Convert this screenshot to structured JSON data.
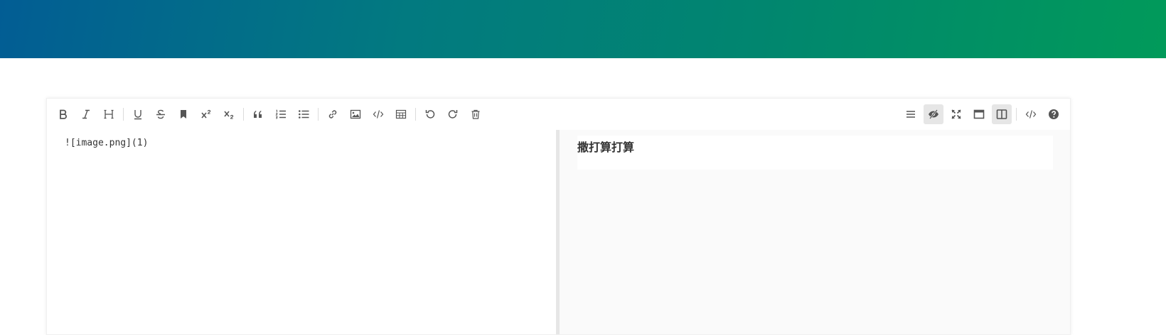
{
  "editor": {
    "source_text": "![image.png](1)",
    "preview_text": "撒打算打算"
  },
  "toolbar": {
    "left_tools": [
      {
        "name": "bold",
        "icon": "bold-icon"
      },
      {
        "name": "italic",
        "icon": "italic-icon"
      },
      {
        "name": "heading",
        "icon": "heading-icon"
      },
      {
        "name": "underline",
        "icon": "underline-icon"
      },
      {
        "name": "strikethrough",
        "icon": "strikethrough-icon"
      },
      {
        "name": "mark",
        "icon": "bookmark-icon"
      },
      {
        "name": "superscript",
        "icon": "superscript-icon"
      },
      {
        "name": "subscript",
        "icon": "subscript-icon"
      },
      {
        "name": "quote",
        "icon": "quote-icon"
      },
      {
        "name": "ordered-list",
        "icon": "ordered-list-icon"
      },
      {
        "name": "unordered-list",
        "icon": "unordered-list-icon"
      },
      {
        "name": "link",
        "icon": "link-icon"
      },
      {
        "name": "image",
        "icon": "image-icon"
      },
      {
        "name": "code",
        "icon": "code-icon"
      },
      {
        "name": "table",
        "icon": "table-icon"
      },
      {
        "name": "undo",
        "icon": "undo-icon"
      },
      {
        "name": "redo",
        "icon": "redo-icon"
      },
      {
        "name": "trash",
        "icon": "trash-icon"
      }
    ],
    "right_tools": [
      {
        "name": "navigation",
        "icon": "list-icon",
        "active": false
      },
      {
        "name": "preview-toggle",
        "icon": "eye-slash-icon",
        "active": true
      },
      {
        "name": "fullscreen",
        "icon": "expand-icon",
        "active": false
      },
      {
        "name": "read-mode",
        "icon": "window-icon",
        "active": false
      },
      {
        "name": "subfield",
        "icon": "columns-icon",
        "active": true
      },
      {
        "name": "html-code",
        "icon": "code-icon",
        "active": false
      },
      {
        "name": "help",
        "icon": "help-icon",
        "active": false
      }
    ]
  },
  "colors": {
    "banner_start": "#025d94",
    "banner_end": "#019a5a",
    "icon": "#555555",
    "preview_bg": "#fafafa"
  }
}
